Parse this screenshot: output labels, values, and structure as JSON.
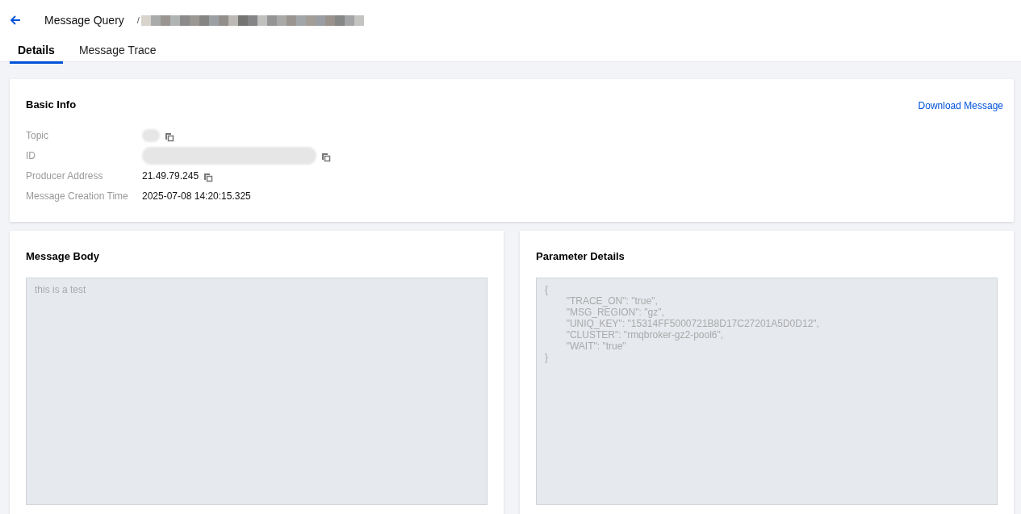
{
  "header": {
    "title": "Message Query",
    "separator": "/"
  },
  "tabs": [
    {
      "label": "Details",
      "selected": true
    },
    {
      "label": "Message Trace",
      "selected": false
    }
  ],
  "basic_info": {
    "title": "Basic Info",
    "action": "Download Message",
    "fields": [
      {
        "label": "Topic",
        "copyable": true
      },
      {
        "label": "ID",
        "copyable": true
      },
      {
        "label": "Producer Address",
        "value": "21.49.79.245",
        "copyable": true
      },
      {
        "label": "Message Creation Time",
        "value": "2025-07-08 14:20:15.325",
        "copyable": false
      }
    ]
  },
  "message_body": {
    "title": "Message Body",
    "value": "this is a test",
    "disabled": true
  },
  "parameter_details": {
    "title": "Parameter Details",
    "value": "{\n        \"TRACE_ON\": \"true\",\n        \"MSG_REGION\": \"gz\",\n        \"UNIQ_KEY\": \"15314FF5000721B8D17C27201A5D0D12\",\n        \"CLUSTER\": \"rmqbroker-gz2-pool6\",\n        \"WAIT\": \"true\"\n}",
    "disabled": true
  }
}
